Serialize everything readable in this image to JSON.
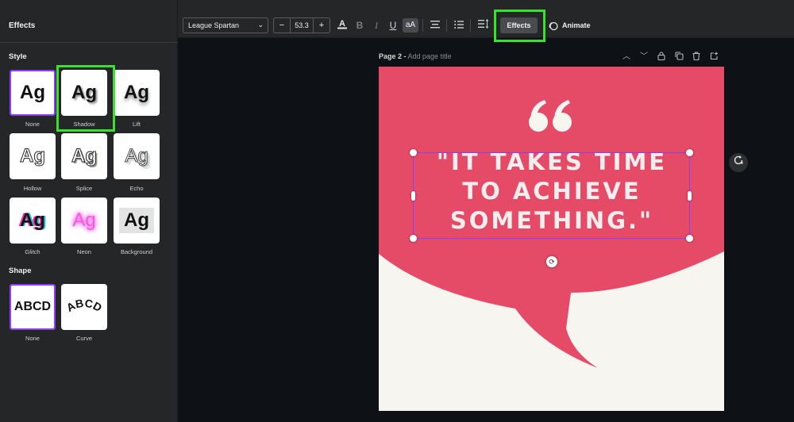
{
  "panel": {
    "title": "Effects",
    "style_label": "Style",
    "shape_label": "Shape",
    "styles": [
      {
        "label": "None",
        "sample": "Ag",
        "selected": true
      },
      {
        "label": "Shadow",
        "sample": "Ag"
      },
      {
        "label": "Lift",
        "sample": "Ag"
      },
      {
        "label": "Hollow",
        "sample": "Ag"
      },
      {
        "label": "Splice",
        "sample": "Ag"
      },
      {
        "label": "Echo",
        "sample": "Ag"
      },
      {
        "label": "Glitch",
        "sample": "Ag"
      },
      {
        "label": "Neon",
        "sample": "Ag"
      },
      {
        "label": "Background",
        "sample": "Ag"
      }
    ],
    "shapes": [
      {
        "label": "None",
        "sample": "ABCD",
        "selected": true
      },
      {
        "label": "Curve",
        "sample": "ABCD"
      }
    ]
  },
  "toolbar": {
    "font_name": "League Spartan",
    "font_size": "53.3",
    "minus": "−",
    "plus": "+",
    "effects_label": "Effects",
    "animate_label": "Animate",
    "icons": [
      "text-color-icon",
      "bold-icon",
      "italic-icon",
      "underline-icon",
      "case-icon",
      "align-center-icon",
      "list-icon",
      "spacing-icon"
    ],
    "case_label": "aA"
  },
  "page": {
    "number_label": "Page 2 -",
    "title_placeholder": "Add page title",
    "quote": "\"IT TAKES TIME TO ACHIEVE SOMETHING.\"",
    "quote_lines": [
      "\"IT TAKES TIME",
      "TO ACHIEVE",
      "SOMETHING.\""
    ]
  },
  "colors": {
    "accent": "#8b3dff",
    "highlight": "#39e22e",
    "bubble": "#e54a67",
    "page_bg": "#f7f5f0"
  }
}
